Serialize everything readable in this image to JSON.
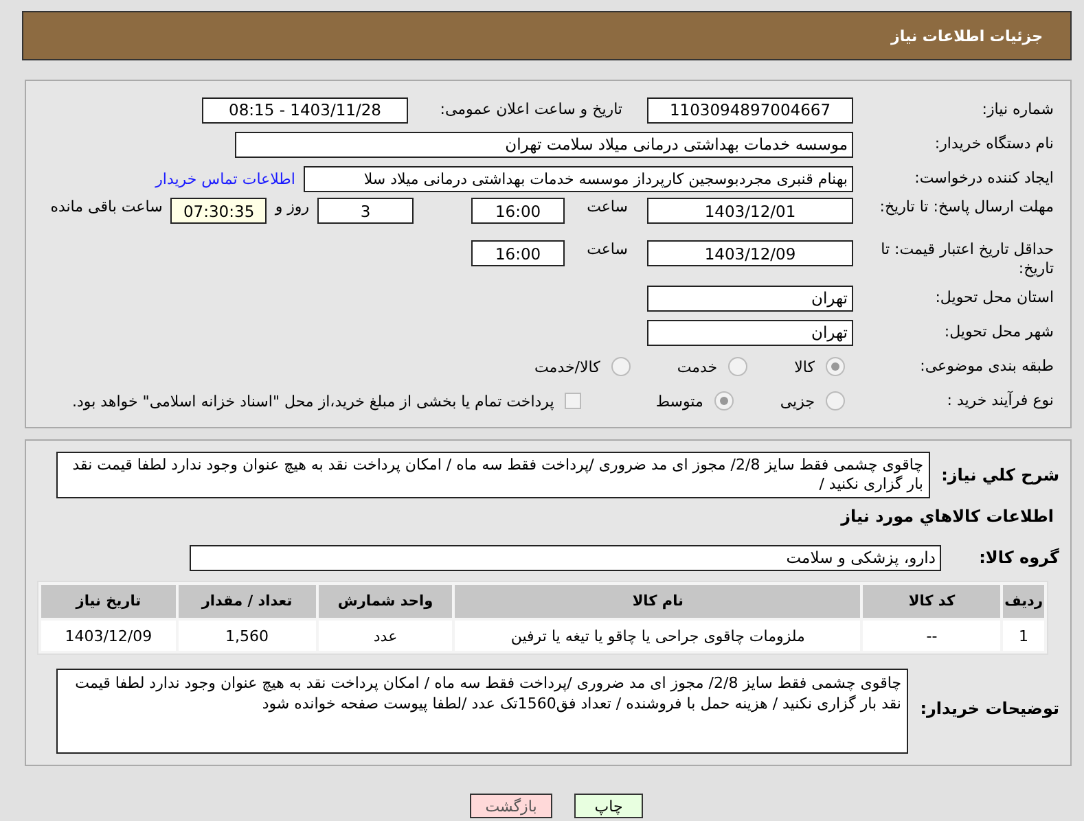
{
  "header": {
    "title": "جزئیات اطلاعات نیاز"
  },
  "need_number": {
    "label": "شماره نیاز:",
    "value": "1103094897004667"
  },
  "announce": {
    "label": "تاریخ و ساعت اعلان عمومی:",
    "value": "1403/11/28 - 08:15"
  },
  "buyer": {
    "label": "نام دستگاه خریدار:",
    "value": "موسسه خدمات بهداشتی درمانی میلاد سلامت تهران"
  },
  "creator": {
    "label": "ایجاد کننده درخواست:",
    "value": "بهنام قنبری مجردبوسجین کارپرداز موسسه خدمات بهداشتی درمانی میلاد سلا",
    "link": "اطلاعات تماس خریدار"
  },
  "deadline": {
    "label": "مهلت ارسال پاسخ: تا تاریخ:",
    "date": "1403/12/01",
    "time_label": "ساعت",
    "time": "16:00",
    "days": "3",
    "days_label": "روز و",
    "remaining": "07:30:35",
    "remaining_label": "ساعت باقی مانده"
  },
  "validity": {
    "label": "حداقل تاریخ اعتبار قیمت: تا تاریخ:",
    "date": "1403/12/09",
    "time_label": "ساعت",
    "time": "16:00"
  },
  "province": {
    "label": "استان محل تحویل:",
    "value": "تهران"
  },
  "city": {
    "label": "شهر محل تحویل:",
    "value": "تهران"
  },
  "category": {
    "label": "طبقه بندی موضوعی:",
    "options": [
      {
        "label": "کالا",
        "selected": true
      },
      {
        "label": "خدمت",
        "selected": false
      },
      {
        "label": "کالا/خدمت",
        "selected": false
      }
    ]
  },
  "process": {
    "label": "نوع فرآیند خرید :",
    "options": [
      {
        "label": "جزیی",
        "selected": false
      },
      {
        "label": "متوسط",
        "selected": true
      }
    ],
    "treasury": {
      "label": "پرداخت تمام یا بخشی از مبلغ خرید،از محل \"اسناد خزانه اسلامی\" خواهد بود.",
      "checked": false
    }
  },
  "summary": {
    "label": "شرح کلي نياز:",
    "value": "چاقوی چشمی فقط سایز 2/8/ مجوز ای مد ضروری /پرداخت  فقط سه ماه / امکان پرداخت نقد به هیچ عنوان وجود ندارد لطفا قیمت نقد بار گزاری نکنید /"
  },
  "goods_heading": "اطلاعات كالاهاي مورد نياز",
  "goods_group": {
    "label": "گروه کالا:",
    "value": "دارو، پزشکی و سلامت"
  },
  "table": {
    "columns": [
      "ردیف",
      "کد کالا",
      "نام کالا",
      "واحد شمارش",
      "تعداد / مقدار",
      "تاریخ نیاز"
    ],
    "rows": [
      [
        "1",
        "--",
        "ملزومات چاقوی جراحی یا چاقو یا تیغه یا ترفین",
        "عدد",
        "1,560",
        "1403/12/09"
      ]
    ]
  },
  "buyer_notes": {
    "label": "توضیحات خریدار:",
    "value": "چاقوی چشمی فقط سایز 2/8/ مجوز ای مد ضروری /پرداخت  فقط سه ماه / امکان پرداخت نقد به هیچ عنوان وجود ندارد لطفا قیمت نقد بار گزاری نکنید / هزینه حمل با فروشنده / تعداد فق1560تک عدد /لطفا پیوست صفحه خوانده شود"
  },
  "buttons": [
    {
      "label": "چاپ",
      "kind": "print"
    },
    {
      "label": "بازگشت",
      "kind": "back"
    }
  ]
}
